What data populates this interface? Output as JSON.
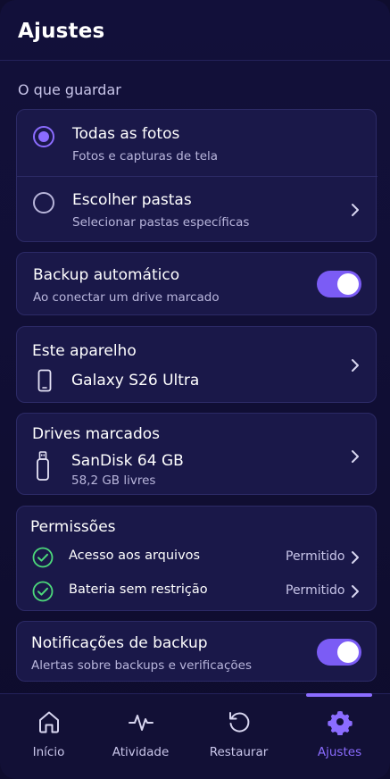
{
  "header": {
    "title": "Ajustes"
  },
  "what_to_save": {
    "section_label": "O que guardar",
    "options": [
      {
        "title": "Todas as fotos",
        "subtitle": "Fotos e capturas de tela",
        "selected": true
      },
      {
        "title": "Escolher pastas",
        "subtitle": "Selecionar pastas específicas",
        "selected": false
      }
    ]
  },
  "auto_backup": {
    "title": "Backup automático",
    "subtitle": "Ao conectar um drive marcado",
    "enabled": true
  },
  "this_device": {
    "title": "Este aparelho",
    "device_name": "Galaxy S26 Ultra",
    "icon": "phone-icon"
  },
  "marked_drives": {
    "title": "Drives marcados",
    "drive_name": "SanDisk 64 GB",
    "free_space": "58,2 GB livres",
    "icon": "usb-drive-icon"
  },
  "permissions": {
    "title": "Permissões",
    "items": [
      {
        "label": "Acesso aos arquivos",
        "status": "Permitido",
        "icon": "check-circle-icon"
      },
      {
        "label": "Bateria sem restrição",
        "status": "Permitido",
        "icon": "check-circle-icon"
      }
    ]
  },
  "notifications": {
    "title": "Notificações de backup",
    "subtitle": "Alertas sobre backups e verificações",
    "enabled": true
  },
  "bottom_nav": {
    "items": [
      {
        "label": "Início",
        "icon": "home-icon",
        "active": false
      },
      {
        "label": "Atividade",
        "icon": "activity-icon",
        "active": false
      },
      {
        "label": "Restaurar",
        "icon": "restore-icon",
        "active": false
      },
      {
        "label": "Ajustes",
        "icon": "gear-icon",
        "active": true
      }
    ]
  },
  "colors": {
    "accent": "#8b6cff",
    "toggle_on": "#7b5cf5",
    "success": "#4cd97b",
    "card_bg": "#1a1849",
    "background": "#110f36"
  }
}
